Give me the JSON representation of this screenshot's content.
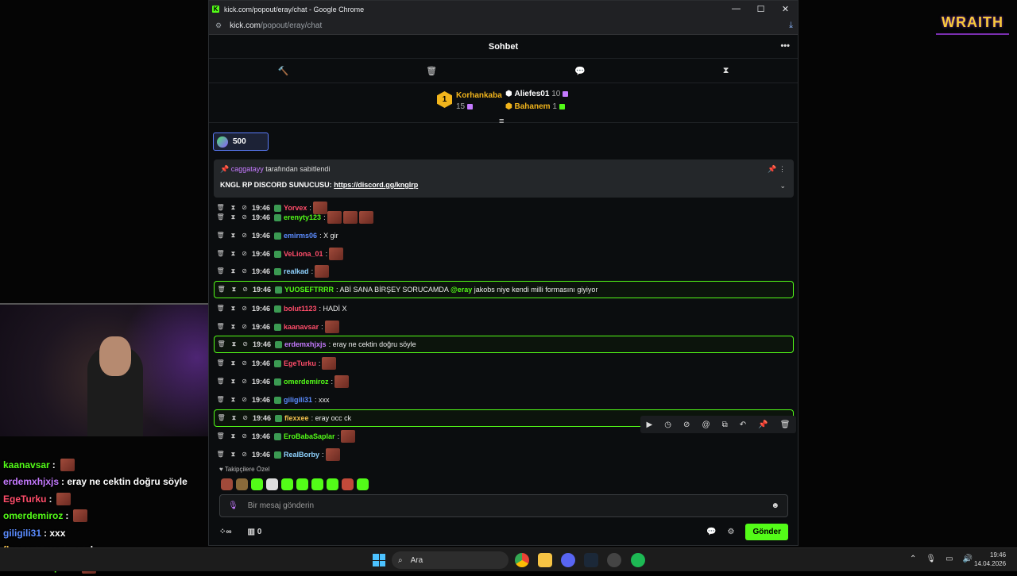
{
  "browser": {
    "title": "kick.com/popout/eray/chat - Google Chrome",
    "url_domain": "kick.com",
    "url_path": "/popout/eray/chat"
  },
  "chat": {
    "header": "Sohbet",
    "leaderboard": {
      "first": {
        "rank": "1",
        "name": "Korhankaba",
        "count": "15"
      },
      "second": {
        "name": "Aliefes01",
        "count": "10"
      },
      "third": {
        "name": "Bahanem",
        "count": "1"
      }
    },
    "kicks": "500",
    "pinned": {
      "by_user": "caggatayy",
      "by_suffix": "tarafından sabitlendi",
      "text": "KNGL RP DISCORD SUNUCUSU:",
      "link": "https://discord.gg/knglrp"
    },
    "messages": [
      {
        "time": "19:46",
        "user": "Yorvex",
        "color": "#ff4d6a",
        "text": ":",
        "emotes": 1
      },
      {
        "time": "19:46",
        "user": "erenyty123",
        "color": "#53fc18",
        "text": ":",
        "emotes": 3
      },
      {
        "time": "19:46",
        "user": "emirms06",
        "color": "#5b8cff",
        "text": ": X gir",
        "emotes": 0
      },
      {
        "time": "19:46",
        "user": "VeLiona_01",
        "color": "#ff4d6a",
        "text": ":",
        "emotes": 1
      },
      {
        "time": "19:46",
        "user": "realkad",
        "color": "#8fd3ff",
        "text": ":",
        "emotes": 1
      },
      {
        "time": "19:46",
        "user": "YUOSEFTRRR",
        "color": "#53fc18",
        "text": ": ABİ SANA BİRŞEY SORUCAMDA",
        "mention": "@eray",
        "text2": "jakobs niye kendi milli formasını giyiyor",
        "emotes": 0
      },
      {
        "time": "19:46",
        "user": "bolut1123",
        "color": "#ff4d6a",
        "text": ": HADİ X",
        "emotes": 0
      },
      {
        "time": "19:46",
        "user": "kaanavsar",
        "color": "#ff4d6a",
        "text": ":",
        "emotes": 1
      },
      {
        "time": "19:46",
        "user": "erdemxhjxjs",
        "color": "#c57aff",
        "text": ": eray ne cektin doğru söyle",
        "emotes": 0
      },
      {
        "time": "19:46",
        "user": "EgeTurku",
        "color": "#ff4d6a",
        "text": ":",
        "emotes": 1
      },
      {
        "time": "19:46",
        "user": "omerdemiroz",
        "color": "#53fc18",
        "text": ":",
        "emotes": 1
      },
      {
        "time": "19:46",
        "user": "giligili31",
        "color": "#5b8cff",
        "text": ": xxx",
        "emotes": 0
      },
      {
        "time": "19:46",
        "user": "flexxee",
        "color": "#f2c14e",
        "text": ": eray occ ck",
        "emotes": 0
      },
      {
        "time": "19:46",
        "user": "EroBabaSaplar",
        "color": "#53fc18",
        "text": ":",
        "emotes": 1
      },
      {
        "time": "19:46",
        "user": "RealBorby",
        "color": "#8fd3ff",
        "text": ":",
        "emotes": 1
      }
    ],
    "follow_label": "Takipçilere Özel",
    "input_placeholder": "Bir mesaj gönderin",
    "points": "0",
    "send_label": "Gönder"
  },
  "overlay": [
    {
      "user": "kaanavsar",
      "color": "#53fc18",
      "text": ":",
      "emote": true
    },
    {
      "user": "erdemxhjxjs",
      "color": "#c57aff",
      "text": ": eray ne cektin doğru söyle",
      "emote": false
    },
    {
      "user": "EgeTurku",
      "color": "#ff4d6a",
      "text": ":",
      "emote": true
    },
    {
      "user": "omerdemiroz",
      "color": "#53fc18",
      "text": ":",
      "emote": true
    },
    {
      "user": "giligili31",
      "color": "#5b8cff",
      "text": ": xxx",
      "emote": false
    },
    {
      "user": "flexxee",
      "color": "#f2c14e",
      "text": ": eray occ ck",
      "emote": false
    },
    {
      "user": "EroBabaSaplar",
      "color": "#53fc18",
      "text": ":",
      "emote": true
    }
  ],
  "logo": "WRAITH",
  "taskbar": {
    "search": "Ara",
    "time": "19:46",
    "date": "14.04.2026"
  }
}
